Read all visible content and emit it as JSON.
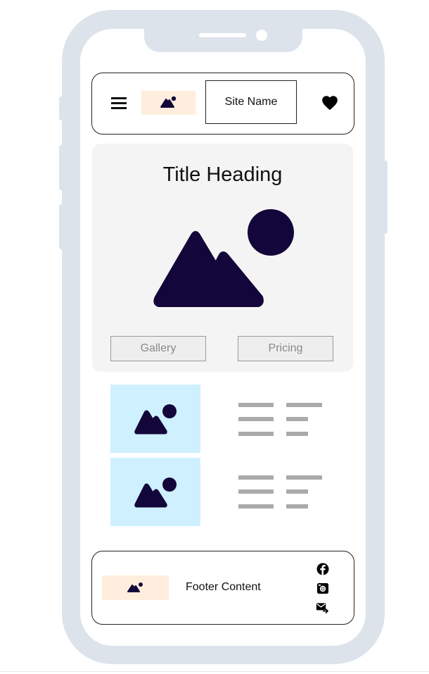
{
  "header": {
    "menu_icon": "hamburger-menu-icon",
    "logo_icon": "image-placeholder-icon",
    "site_name": "Site Name",
    "favorite_icon": "heart-icon"
  },
  "hero": {
    "title": "Title Heading",
    "image_icon": "image-placeholder-icon",
    "buttons": [
      {
        "label": "Gallery"
      },
      {
        "label": "Pricing"
      }
    ]
  },
  "content_rows": [
    {
      "image_icon": "image-placeholder-icon",
      "text": "text-placeholder-lines"
    },
    {
      "image_icon": "image-placeholder-icon",
      "text": "text-placeholder-lines"
    }
  ],
  "footer": {
    "logo_icon": "image-placeholder-icon",
    "text": "Footer Content",
    "social_icons": [
      "facebook-icon",
      "instagram-icon",
      "email-forward-icon"
    ]
  },
  "colors": {
    "frame": "#dde3eb",
    "icon_dark": "#13063a",
    "logo_bg": "#ffeedd",
    "thumb_bg": "#cff0ff",
    "hero_bg": "#f4f4f4",
    "line_gray": "#aaaaaa"
  }
}
